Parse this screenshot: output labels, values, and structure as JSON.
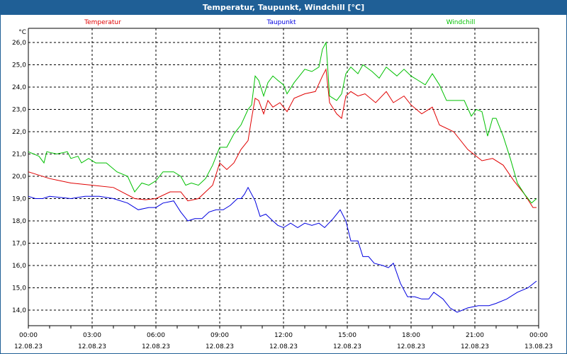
{
  "window": {
    "title": "Temperatur, Taupunkt, Windchill [°C]"
  },
  "chart_data": {
    "type": "line",
    "title": "Temperatur, Taupunkt, Windchill [°C]",
    "ylabel": "°C",
    "xlabel": "",
    "ylim": [
      13.3,
      26.6
    ],
    "xlim_minutes": [
      0,
      1440
    ],
    "grid": true,
    "legend_placement": "top",
    "yticks": [
      "14,0",
      "15,0",
      "16,0",
      "17,0",
      "18,0",
      "19,0",
      "20,0",
      "21,0",
      "22,0",
      "23,0",
      "24,0",
      "25,0",
      "26,0"
    ],
    "ytick_values": [
      14,
      15,
      16,
      17,
      18,
      19,
      20,
      21,
      22,
      23,
      24,
      25,
      26
    ],
    "xticks": [
      {
        "time": "00:00",
        "date": "12.08.23"
      },
      {
        "time": "03:00",
        "date": "12.08.23"
      },
      {
        "time": "06:00",
        "date": "12.08.23"
      },
      {
        "time": "09:00",
        "date": "12.08.23"
      },
      {
        "time": "12:00",
        "date": "12.08.23"
      },
      {
        "time": "15:00",
        "date": "12.08.23"
      },
      {
        "time": "18:00",
        "date": "12.08.23"
      },
      {
        "time": "21:00",
        "date": "12.08.23"
      },
      {
        "time": "00:00",
        "date": "13.08.23"
      }
    ],
    "series": [
      {
        "name": "Temperatur",
        "color": "#e00000",
        "x": [
          0,
          60,
          120,
          180,
          240,
          300,
          330,
          360,
          400,
          430,
          450,
          480,
          520,
          540,
          560,
          580,
          600,
          620,
          630,
          640,
          650,
          664,
          676,
          690,
          710,
          730,
          750,
          780,
          810,
          830,
          840,
          850,
          870,
          884,
          896,
          910,
          930,
          950,
          980,
          1010,
          1030,
          1060,
          1080,
          1110,
          1140,
          1160,
          1200,
          1240,
          1280,
          1310,
          1340,
          1370,
          1400,
          1424,
          1434
        ],
        "y": [
          20.2,
          19.9,
          19.7,
          19.6,
          19.5,
          19.0,
          18.95,
          19.0,
          19.3,
          19.3,
          18.9,
          19.0,
          19.6,
          20.6,
          20.3,
          20.6,
          21.2,
          21.6,
          22.6,
          23.5,
          23.4,
          22.8,
          23.4,
          23.1,
          23.3,
          22.9,
          23.5,
          23.7,
          23.8,
          24.5,
          24.8,
          23.3,
          22.8,
          22.6,
          23.6,
          23.8,
          23.6,
          23.7,
          23.3,
          23.8,
          23.3,
          23.6,
          23.2,
          22.8,
          23.1,
          22.3,
          22.0,
          21.2,
          20.7,
          20.8,
          20.5,
          19.8,
          19.2,
          18.6,
          18.6
        ]
      },
      {
        "name": "Taupunkt",
        "color": "#0000e0",
        "x": [
          0,
          20,
          40,
          60,
          120,
          160,
          200,
          240,
          280,
          310,
          340,
          360,
          380,
          410,
          430,
          450,
          470,
          490,
          510,
          530,
          550,
          570,
          590,
          600,
          610,
          620,
          640,
          654,
          670,
          690,
          704,
          720,
          740,
          760,
          780,
          800,
          820,
          836,
          860,
          880,
          896,
          910,
          930,
          944,
          960,
          976,
          1000,
          1016,
          1030,
          1050,
          1070,
          1090,
          1110,
          1130,
          1144,
          1170,
          1190,
          1210,
          1240,
          1270,
          1300,
          1320,
          1350,
          1380,
          1410,
          1434
        ],
        "y": [
          19.1,
          19.0,
          19.0,
          19.1,
          19.0,
          19.1,
          19.1,
          19.0,
          18.8,
          18.5,
          18.6,
          18.6,
          18.8,
          18.9,
          18.4,
          18.0,
          18.1,
          18.1,
          18.4,
          18.5,
          18.5,
          18.7,
          19.0,
          19.0,
          19.2,
          19.5,
          18.9,
          18.2,
          18.3,
          18.0,
          17.8,
          17.7,
          17.9,
          17.7,
          17.9,
          17.8,
          17.9,
          17.7,
          18.1,
          18.5,
          18.0,
          17.1,
          17.1,
          16.4,
          16.4,
          16.1,
          16.0,
          15.9,
          16.1,
          15.2,
          14.6,
          14.6,
          14.5,
          14.5,
          14.8,
          14.5,
          14.1,
          13.9,
          14.1,
          14.2,
          14.2,
          14.3,
          14.5,
          14.8,
          15.0,
          15.3
        ]
      },
      {
        "name": "Windchill",
        "color": "#00c000",
        "x": [
          0,
          30,
          44,
          52,
          80,
          110,
          120,
          140,
          150,
          170,
          190,
          220,
          250,
          280,
          300,
          320,
          340,
          360,
          380,
          410,
          430,
          444,
          460,
          480,
          500,
          520,
          540,
          560,
          580,
          600,
          620,
          630,
          640,
          650,
          664,
          676,
          690,
          704,
          720,
          730,
          750,
          780,
          800,
          820,
          830,
          840,
          850,
          870,
          884,
          896,
          910,
          930,
          944,
          970,
          990,
          1010,
          1040,
          1060,
          1080,
          1100,
          1120,
          1140,
          1160,
          1180,
          1210,
          1230,
          1250,
          1264,
          1280,
          1296,
          1310,
          1320,
          1340,
          1360,
          1380,
          1400,
          1420,
          1434
        ],
        "y": [
          21.1,
          20.9,
          20.6,
          21.1,
          21.0,
          21.1,
          20.8,
          20.9,
          20.6,
          20.8,
          20.6,
          20.6,
          20.2,
          20.0,
          19.3,
          19.7,
          19.6,
          19.8,
          20.2,
          20.2,
          20.0,
          19.6,
          19.7,
          19.6,
          19.9,
          20.5,
          21.3,
          21.3,
          21.9,
          22.3,
          23.0,
          23.2,
          24.5,
          24.3,
          23.6,
          24.2,
          24.5,
          24.3,
          24.1,
          23.7,
          24.2,
          24.8,
          24.7,
          24.9,
          25.7,
          26.0,
          23.6,
          23.4,
          23.7,
          24.6,
          24.9,
          24.6,
          25.0,
          24.7,
          24.4,
          24.9,
          24.5,
          24.8,
          24.5,
          24.3,
          24.1,
          24.6,
          24.1,
          23.4,
          23.4,
          23.4,
          22.7,
          23.0,
          22.9,
          21.8,
          22.6,
          22.6,
          21.8,
          20.8,
          19.7,
          19.2,
          18.8,
          19.0
        ]
      }
    ]
  }
}
